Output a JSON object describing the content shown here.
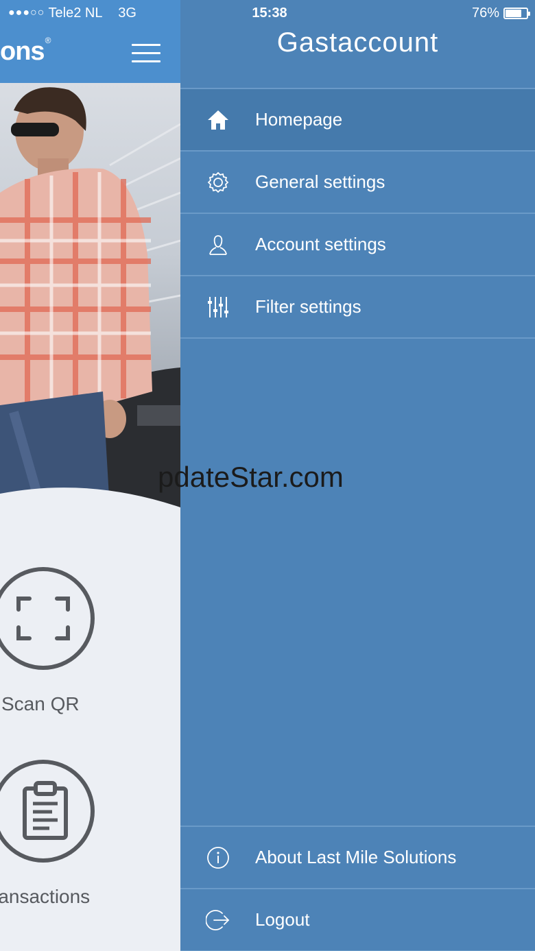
{
  "status_bar": {
    "signal": "●●●○○",
    "carrier": "Tele2 NL",
    "network": "3G",
    "time": "15:38",
    "battery": "76%",
    "battery_level": 0.76
  },
  "main": {
    "brand_fragment": "ons",
    "brand_mark": "®",
    "actions": [
      {
        "label": "Scan QR",
        "icon": "qr-scan-icon"
      },
      {
        "label": "ransactions",
        "icon": "clipboard-icon"
      }
    ]
  },
  "drawer": {
    "title": "Gastaccount",
    "items": [
      {
        "label": "Homepage",
        "icon": "home-icon",
        "active": true
      },
      {
        "label": "General settings",
        "icon": "gear-icon",
        "active": false
      },
      {
        "label": "Account settings",
        "icon": "user-icon",
        "active": false
      },
      {
        "label": "Filter settings",
        "icon": "sliders-icon",
        "active": false
      }
    ],
    "bottom_items": [
      {
        "label": "About Last Mile Solutions",
        "icon": "info-icon"
      },
      {
        "label": "Logout",
        "icon": "logout-icon"
      }
    ]
  },
  "watermark": "pdateStar.com",
  "colors": {
    "drawer_bg": "#4d83b7",
    "header_bg": "#4c8fce",
    "active_item": "#457aac",
    "divider": "#6a9ac8",
    "icon_gray": "#575a5f"
  }
}
